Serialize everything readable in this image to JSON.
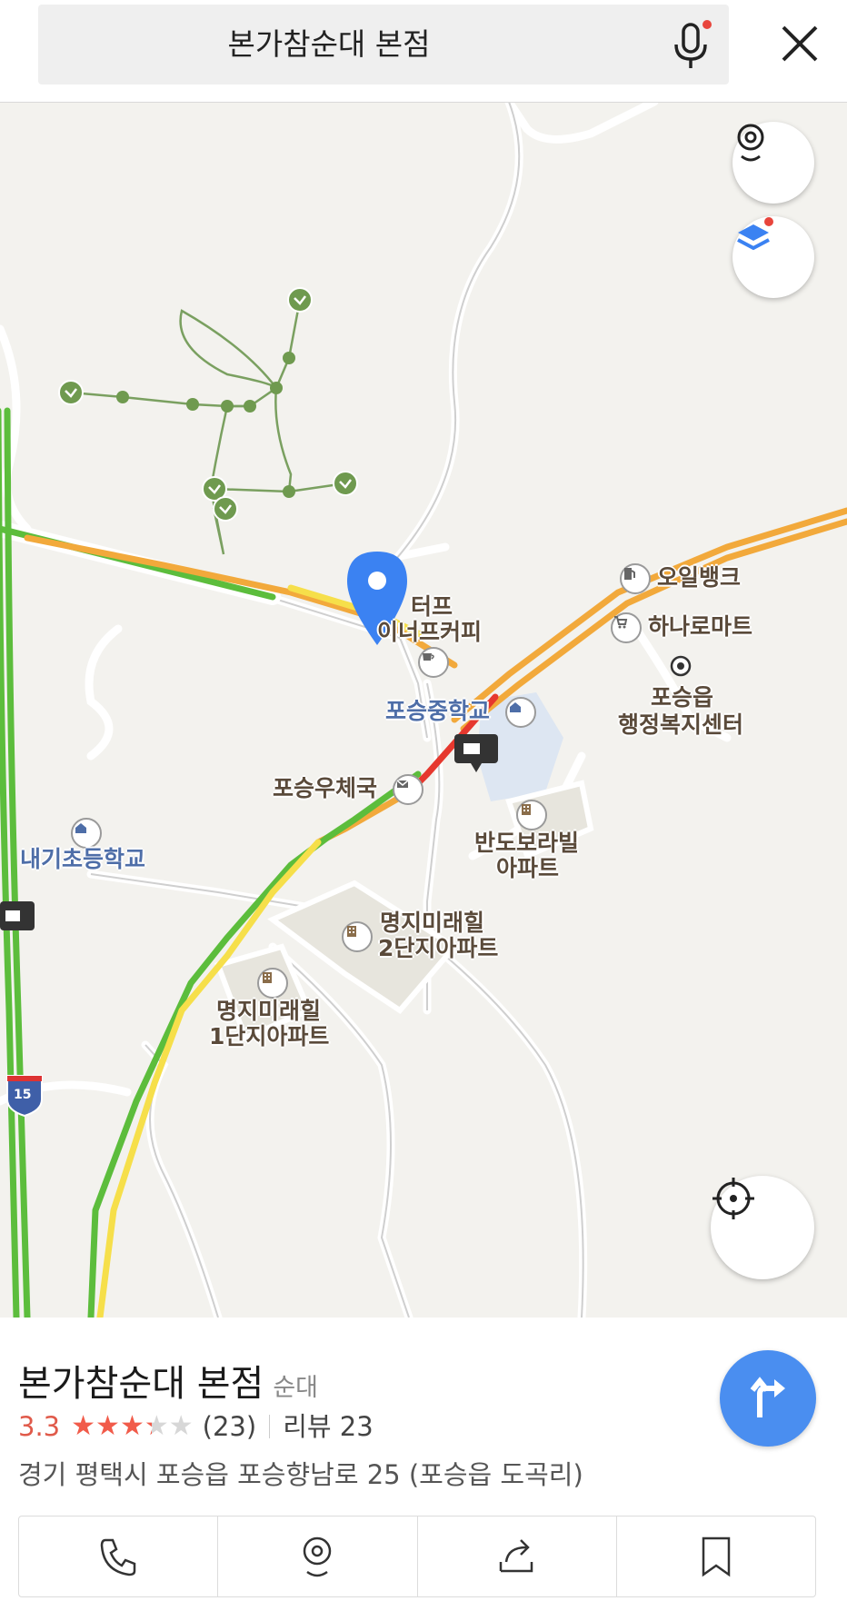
{
  "search": {
    "query": "본가참순대 본점"
  },
  "map": {
    "pois": [
      {
        "id": "oilbank",
        "label": "오일뱅크"
      },
      {
        "id": "hanaro",
        "label": "하나로마트"
      },
      {
        "id": "teope",
        "label": "터프"
      },
      {
        "id": "innisfree",
        "label": "이너프커피"
      },
      {
        "id": "poseung_middle",
        "label": "포승중학교"
      },
      {
        "id": "welfare1",
        "label": "포승읍"
      },
      {
        "id": "welfare2",
        "label": "행정복지센터"
      },
      {
        "id": "post",
        "label": "포승우체국"
      },
      {
        "id": "bando1",
        "label": "반도보라빌"
      },
      {
        "id": "bando2",
        "label": "아파트"
      },
      {
        "id": "naegi",
        "label": "내기초등학교"
      },
      {
        "id": "myungji2a",
        "label": "명지미래힐"
      },
      {
        "id": "myungji2b",
        "label": "2단지아파트"
      },
      {
        "id": "myungji1a",
        "label": "명지미래힐"
      },
      {
        "id": "myungji1b",
        "label": "1단지아파트"
      }
    ],
    "highway_shield": "15"
  },
  "place": {
    "name": "본가참순대 본점",
    "category": "순대",
    "rating": "3.3",
    "rating_value": 3.3,
    "rating_max": 5,
    "review_count": "(23)",
    "review_label": "리뷰 23",
    "address": "경기 평택시 포승읍 포승향남로 25 (포승읍 도곡리)"
  },
  "colors": {
    "accent": "#4a8ef0",
    "star": "#f15b4a",
    "rating": "#e05a4a"
  }
}
